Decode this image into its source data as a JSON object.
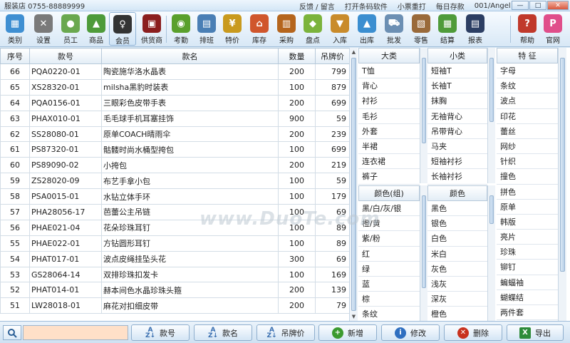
{
  "titlebar": {
    "title": "服装店 0755-88889999",
    "menus": [
      "反馈 / 留言",
      "打开条码软件",
      "小票重打",
      "每日存款",
      "001/Angel"
    ],
    "min_label": "—",
    "max_label": "□",
    "close_label": "✕"
  },
  "toolbar": {
    "items": [
      {
        "label": "类别",
        "icon": "category-icon",
        "color": "#3f8fd2",
        "glyph": "▦"
      },
      {
        "label": "设置",
        "icon": "settings-tools-icon",
        "color": "#7a7a7a",
        "glyph": "✕"
      },
      {
        "label": "员工",
        "icon": "staff-icon",
        "color": "#6aa84f",
        "glyph": "●"
      },
      {
        "label": "商品",
        "icon": "goods-icon",
        "color": "#4e9b3a",
        "glyph": "▲"
      },
      {
        "label": "会员",
        "icon": "member-icon",
        "color": "#333333",
        "glyph": "♀"
      },
      {
        "label": "供货商",
        "icon": "supplier-icon",
        "color": "#8b1f1f",
        "glyph": "▣"
      },
      {
        "label": "考勤",
        "icon": "attendance-icon",
        "color": "#5aa02c",
        "glyph": "◉"
      },
      {
        "label": "排班",
        "icon": "schedule-icon",
        "color": "#4a7fb5",
        "glyph": "▤"
      },
      {
        "label": "特价",
        "icon": "special-price-icon",
        "color": "#c99a1e",
        "glyph": "¥"
      },
      {
        "label": "库存",
        "icon": "inventory-icon",
        "color": "#d0562c",
        "glyph": "⌂"
      },
      {
        "label": "采购",
        "icon": "purchase-icon",
        "color": "#b5651d",
        "glyph": "▥"
      },
      {
        "label": "盘点",
        "icon": "stocktake-icon",
        "color": "#7bb33b",
        "glyph": "◆"
      },
      {
        "label": "入库",
        "icon": "stock-in-icon",
        "color": "#c98b2b",
        "glyph": "▼"
      },
      {
        "label": "出库",
        "icon": "stock-out-icon",
        "color": "#3b8ed0",
        "glyph": "▲"
      },
      {
        "label": "批发",
        "icon": "wholesale-icon",
        "color": "#6c8fb3",
        "glyph": "⛟"
      },
      {
        "label": "零售",
        "icon": "retail-icon",
        "color": "#9a6a3a",
        "glyph": "▧"
      },
      {
        "label": "结算",
        "icon": "settlement-icon",
        "color": "#4f9b3a",
        "glyph": "▦"
      },
      {
        "label": "报表",
        "icon": "report-icon",
        "color": "#2c3e63",
        "glyph": "▤"
      },
      {
        "label": "帮助",
        "icon": "help-icon",
        "color": "#c0392b",
        "glyph": "?"
      },
      {
        "label": "官网",
        "icon": "website-icon",
        "color": "#e04e8a",
        "glyph": "P"
      }
    ]
  },
  "products": {
    "headers": [
      "序号",
      "款号",
      "款名",
      "数量",
      "吊牌价"
    ],
    "rows": [
      [
        "66",
        "PQA0220-01",
        "陶瓷施华洛水晶表",
        "200",
        "799"
      ],
      [
        "65",
        "XS28320-01",
        "milsha黑豹时装表",
        "100",
        "879"
      ],
      [
        "64",
        "PQA0156-01",
        "三眼彩色皮带手表",
        "200",
        "699"
      ],
      [
        "63",
        "PHAX010-01",
        "毛毛球手机耳塞挂饰",
        "900",
        "59"
      ],
      [
        "62",
        "SS28080-01",
        "原单COACH晴雨伞",
        "200",
        "239"
      ],
      [
        "61",
        "PS87320-01",
        "骷髅时尚水桶型挎包",
        "100",
        "699"
      ],
      [
        "60",
        "PS89090-02",
        "小挎包",
        "200",
        "219"
      ],
      [
        "59",
        "ZS28020-09",
        "布艺手拿小包",
        "100",
        "59"
      ],
      [
        "58",
        "PSA0015-01",
        "水钻立体手环",
        "100",
        "179"
      ],
      [
        "57",
        "PHA28056-17",
        "芭蕾公主吊链",
        "100",
        "69"
      ],
      [
        "56",
        "PHAE021-04",
        "花朵珍珠耳钉",
        "100",
        "89"
      ],
      [
        "55",
        "PHAE022-01",
        "方钻圆形耳钉",
        "100",
        "89"
      ],
      [
        "54",
        "PHAT017-01",
        "波点皮绳挂坠头花",
        "300",
        "69"
      ],
      [
        "53",
        "GS28064-14",
        "双排珍珠扣发卡",
        "100",
        "169"
      ],
      [
        "52",
        "PHAT014-01",
        "赫本间色水晶珍珠头箍",
        "200",
        "139"
      ],
      [
        "51",
        "LW28018-01",
        "麻花对扣细皮带",
        "200",
        "79"
      ]
    ]
  },
  "panels": {
    "major_header": "大类",
    "major": [
      "T恤",
      "背心",
      "衬衫",
      "毛衫",
      "外套",
      "半裙",
      "连衣裙",
      "裤子"
    ],
    "minor_header": "小类",
    "minor": [
      "短袖T",
      "长袖T",
      "抹胸",
      "无袖背心",
      "吊带背心",
      "马夹",
      "短袖衬衫",
      "长袖衬衫"
    ],
    "color_group_header": "颜色(组)",
    "color_group": [
      "黑/白/灰/银",
      "橙/黄",
      "紫/粉",
      "红",
      "绿",
      "蓝",
      "棕",
      "条纹"
    ],
    "color_header": "颜色",
    "color": [
      "黑色",
      "银色",
      "白色",
      "米白",
      "灰色",
      "浅灰",
      "深灰",
      "橙色"
    ],
    "feature_header": "特 征",
    "feature": [
      "字母",
      "条纹",
      "波点",
      "印花",
      "蕾丝",
      "网纱",
      "针织",
      "撞色",
      "拼色",
      "原单",
      "韩版",
      "亮片",
      "珍珠",
      "铆钉",
      "蝙蝠袖",
      "蝴蝶结",
      "两件套"
    ]
  },
  "bottombar": {
    "search_placeholder": "",
    "sort_code_label": "款号",
    "sort_name_label": "款名",
    "sort_price_label": "吊牌价",
    "add_label": "新增",
    "edit_label": "修改",
    "delete_label": "删除",
    "export_label": "导出"
  },
  "watermark": "www.DuoTe.com"
}
